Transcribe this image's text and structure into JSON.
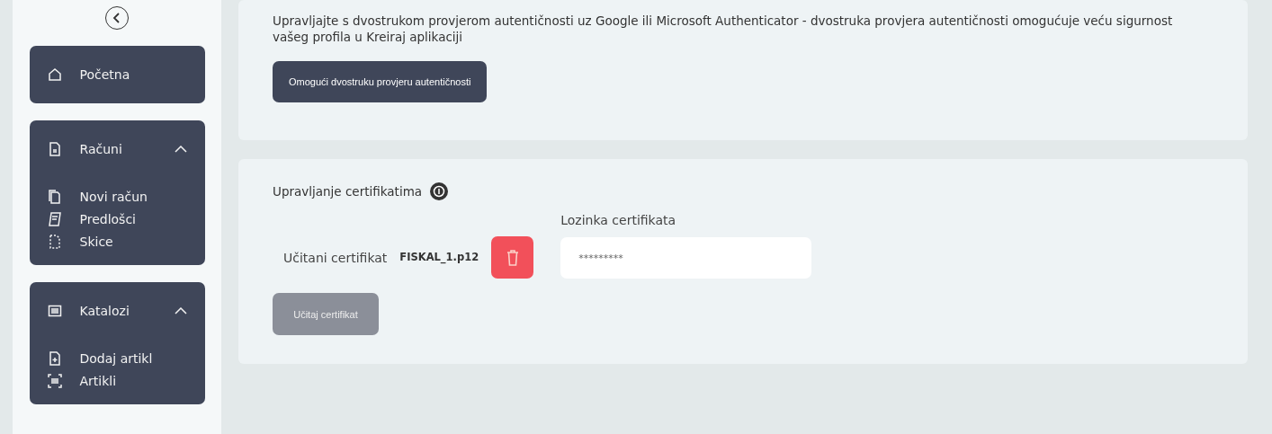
{
  "sidebar": {
    "items": [
      {
        "label": "Početna"
      },
      {
        "label": "Računi",
        "expanded": true,
        "children": [
          {
            "label": "Novi račun"
          },
          {
            "label": "Predlošci"
          },
          {
            "label": "Skice"
          }
        ]
      },
      {
        "label": "Katalozi",
        "expanded": true,
        "children": [
          {
            "label": "Dodaj artikl"
          },
          {
            "label": "Artikli"
          }
        ]
      }
    ]
  },
  "two_factor": {
    "description": "Upravljajte s dvostrukom provjerom autentičnosti uz Google ili Microsoft Authenticator - dvostruka provjera autentičnosti omogućuje veću sigurnost vašeg profila u Kreiraj aplikaciji",
    "button": "Omogući dvostruku provjeru autentičnosti"
  },
  "certificates": {
    "title": "Upravljanje certifikatima",
    "loaded_label": "Učitani certifikat",
    "loaded_file": "FISKAL_1.p12",
    "password_label": "Lozinka certifikata",
    "password_value": "*********",
    "upload_button": {
      "label": "Učitaj certifikat",
      "disabled": true
    }
  }
}
